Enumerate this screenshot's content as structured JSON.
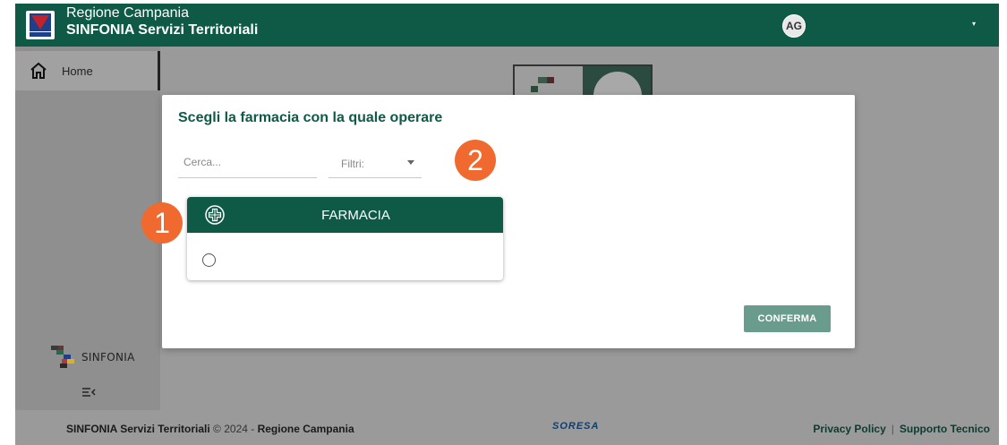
{
  "header": {
    "title_line1": "Regione Campania",
    "title_line2": "SINFONIA Servizi Territoriali",
    "avatar_initials": "AG",
    "user_menu_caret": "▾"
  },
  "sidebar": {
    "items": [
      {
        "label": "Home",
        "icon": "home-icon"
      }
    ],
    "logo_text": "SINFONIA",
    "collapse_icon": "collapse-menu-icon"
  },
  "modal": {
    "title": "Scegli la farmacia con la quale operare",
    "search_placeholder": "Cerca...",
    "filter_label": "Filtri:",
    "card_header": "FARMACIA",
    "card_icon": "pharmacy-cross-icon",
    "confirm_label": "CONFERMA"
  },
  "badges": {
    "step1": "1",
    "step2": "2"
  },
  "footer": {
    "app_name": "SINFONIA Servizi Territoriali",
    "copyright": " © 2024 - ",
    "region": "Regione Campania",
    "center_logo": "SORESA",
    "privacy": "Privacy Policy",
    "separator": "|",
    "support": "Supporto Tecnico"
  },
  "colors": {
    "brand_green": "#0e5a46",
    "badge_orange": "#f0692f",
    "confirm_button": "#6a9c8d"
  }
}
